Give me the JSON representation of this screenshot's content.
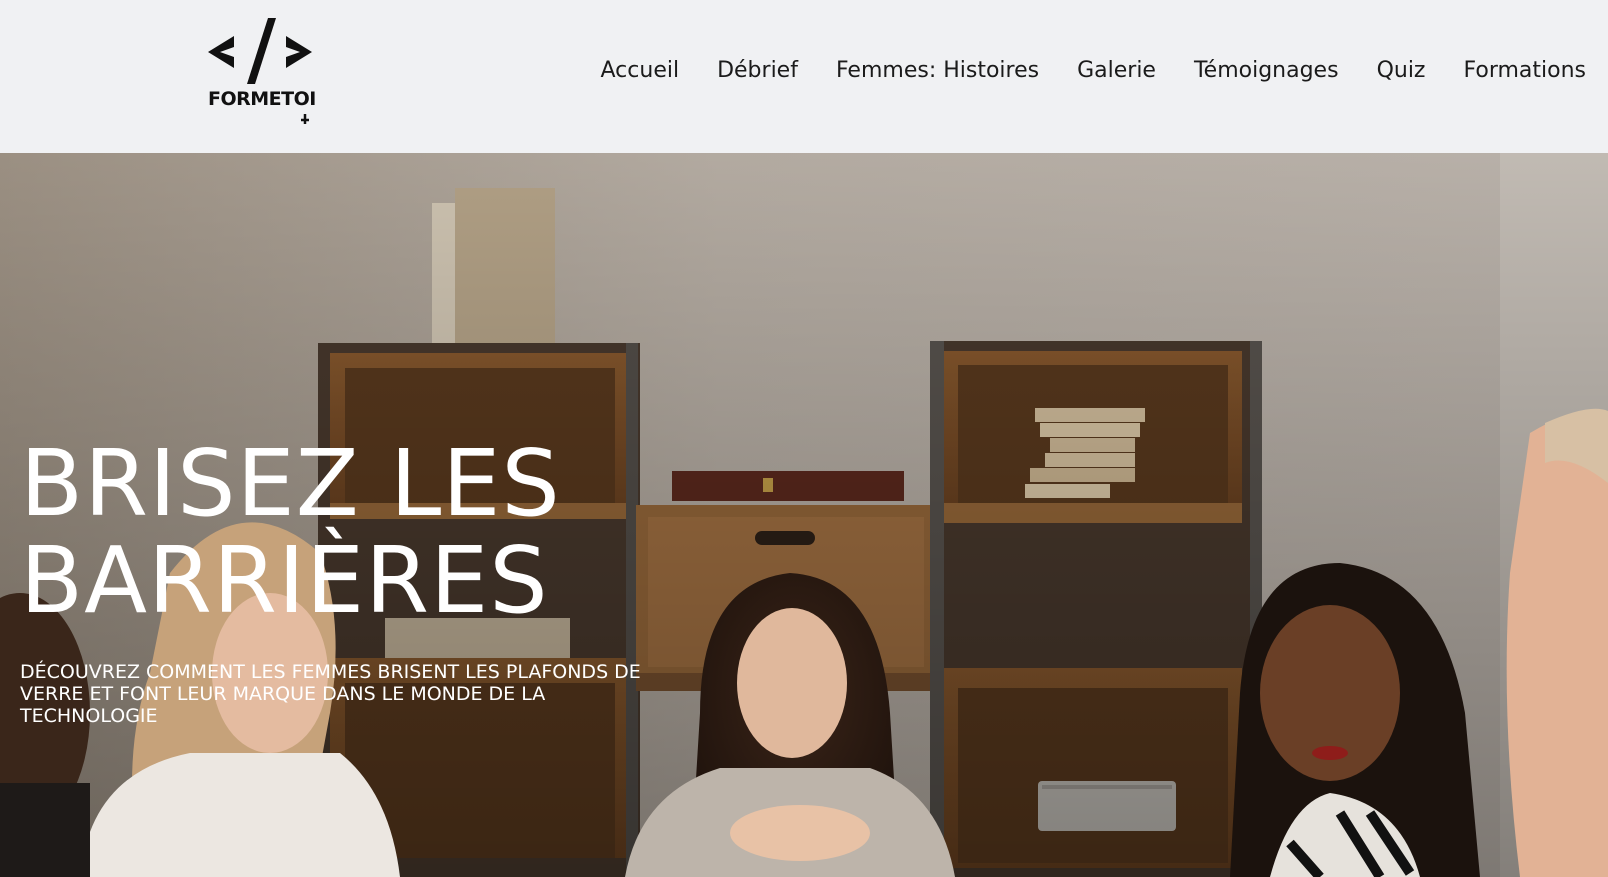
{
  "brand": {
    "name": "FORMETOI",
    "logo_icon": "code-brackets-icon"
  },
  "nav": {
    "items": [
      {
        "label": "Accueil"
      },
      {
        "label": "Débrief"
      },
      {
        "label": "Femmes: Histoires"
      },
      {
        "label": "Galerie"
      },
      {
        "label": "Témoignages"
      },
      {
        "label": "Quiz"
      },
      {
        "label": "Formations"
      }
    ]
  },
  "hero": {
    "title": "BRISEZ LES BARRIÈRES",
    "subtitle": "DÉCOUVREZ COMMENT LES FEMMES BRISENT LES PLAFONDS DE VERRE ET FONT LEUR MARQUE DANS LE MONDE DE LA TECHNOLOGIE",
    "background": "photo-women-meeting-office-shelves"
  },
  "colors": {
    "header_bg": "#f0f1f3",
    "nav_text": "#1b1b1b",
    "hero_text": "#ffffff"
  }
}
